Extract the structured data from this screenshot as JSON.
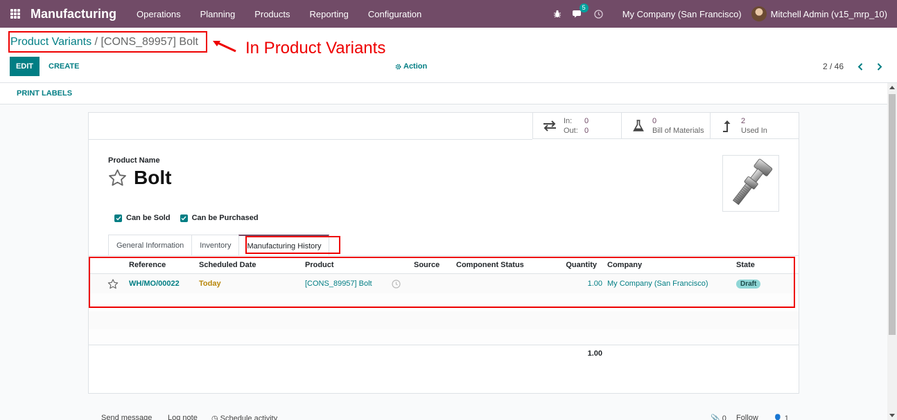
{
  "navbar": {
    "app_name": "Manufacturing",
    "menu": [
      "Operations",
      "Planning",
      "Products",
      "Reporting",
      "Configuration"
    ],
    "messages_count": "5",
    "company": "My Company (San Francisco)",
    "user": "Mitchell Admin (v15_mrp_10)"
  },
  "breadcrumb": {
    "parent": "Product Variants",
    "separator": " / ",
    "current": "[CONS_89957] Bolt"
  },
  "annotation": "In Product Variants",
  "buttons": {
    "edit": "EDIT",
    "create": "CREATE",
    "action": "Action",
    "print_labels": "PRINT LABELS"
  },
  "pager": {
    "value": "2 / 46"
  },
  "stats": {
    "in_label": "In:",
    "in_value": "0",
    "out_label": "Out:",
    "out_value": "0",
    "bom_value": "0",
    "bom_label": "Bill of Materials",
    "used_value": "2",
    "used_label": "Used In"
  },
  "product": {
    "name_label": "Product Name",
    "name": "Bolt",
    "can_be_sold": "Can be Sold",
    "can_be_purchased": "Can be Purchased"
  },
  "tabs": [
    "General Information",
    "Inventory",
    "Manufacturing History"
  ],
  "table": {
    "headers": {
      "reference": "Reference",
      "scheduled_date": "Scheduled Date",
      "product": "Product",
      "source": "Source",
      "component_status": "Component Status",
      "quantity": "Quantity",
      "company": "Company",
      "state": "State"
    },
    "row": {
      "reference": "WH/MO/00022",
      "scheduled_date": "Today",
      "product": "[CONS_89957] Bolt",
      "source": "",
      "component_status": "",
      "quantity": "1.00",
      "company": "My Company (San Francisco)",
      "state": "Draft"
    },
    "total_quantity": "1.00"
  },
  "chatter": {
    "send_message": "Send message",
    "log_note": "Log note",
    "schedule_activity": "Schedule activity",
    "attachments": "0",
    "follow": "Follow",
    "followers": "1"
  }
}
